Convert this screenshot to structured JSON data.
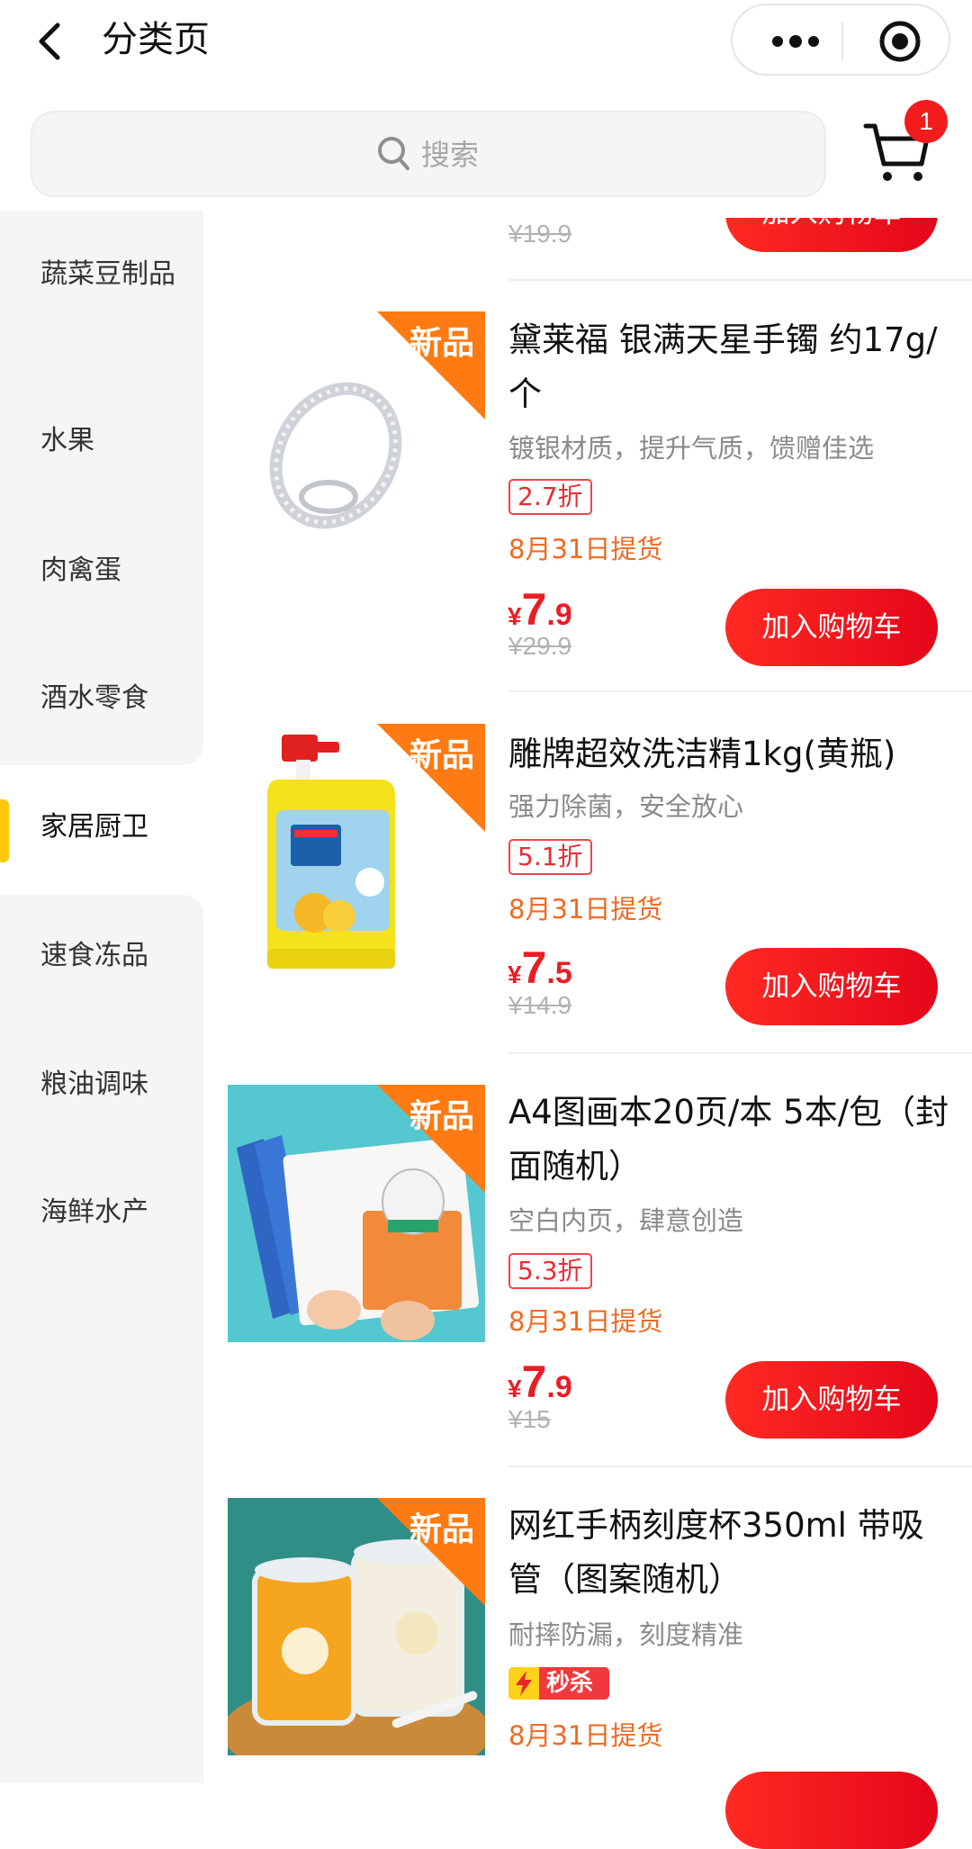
{
  "nav": {
    "title": "分类页"
  },
  "search": {
    "placeholder": "搜索"
  },
  "cart": {
    "badge": "1"
  },
  "sidebar": {
    "items": [
      {
        "label": "蔬菜豆制品"
      },
      {
        "label": "水果"
      },
      {
        "label": "肉禽蛋"
      },
      {
        "label": "酒水零食"
      },
      {
        "label": "家居厨卫"
      },
      {
        "label": "速食冻品"
      },
      {
        "label": "粮油调味"
      },
      {
        "label": "海鲜水产"
      }
    ],
    "active": "家居厨卫"
  },
  "partial_top": {
    "original_price": "¥19.9",
    "button": "加入购物车"
  },
  "new_tag": "新品",
  "flash_sale_label": "秒杀",
  "products": [
    {
      "name": "黛莱福 银满天星手镯 约17g/个",
      "subtitle": "镀银材质，提升气质，馈赠佳选",
      "discount": "2.7折",
      "pickup": "8月31日提货",
      "price_currency": "¥",
      "price_int": "7",
      "price_dec": ".9",
      "original_price": "¥29.9",
      "button": "加入购物车",
      "image": "silver-bangle"
    },
    {
      "name": "雕牌超效洗洁精1kg(黄瓶)",
      "subtitle": "强力除菌，安全放心",
      "discount": "5.1折",
      "pickup": "8月31日提货",
      "price_currency": "¥",
      "price_int": "7",
      "price_dec": ".5",
      "original_price": "¥14.9",
      "button": "加入购物车",
      "image": "dish-soap-bottle"
    },
    {
      "name": "A4图画本20页/本 5本/包（封面随机）",
      "subtitle": "空白内页，肆意创造",
      "discount": "5.3折",
      "pickup": "8月31日提货",
      "price_currency": "¥",
      "price_int": "7",
      "price_dec": ".9",
      "original_price": "¥15",
      "button": "加入购物车",
      "image": "drawing-book"
    },
    {
      "name": "网红手柄刻度杯350ml 带吸管（图案随机）",
      "subtitle": "耐摔防漏，刻度精准",
      "pickup": "8月31日提货",
      "image": "measuring-cups"
    }
  ],
  "colors": {
    "accent_red": "#ea1d25",
    "pickup_orange": "#f06a24",
    "sidebar_bg": "#f4f5f6",
    "active_marker": "#ffc60b",
    "new_tag_orange": "#ff7a12"
  }
}
